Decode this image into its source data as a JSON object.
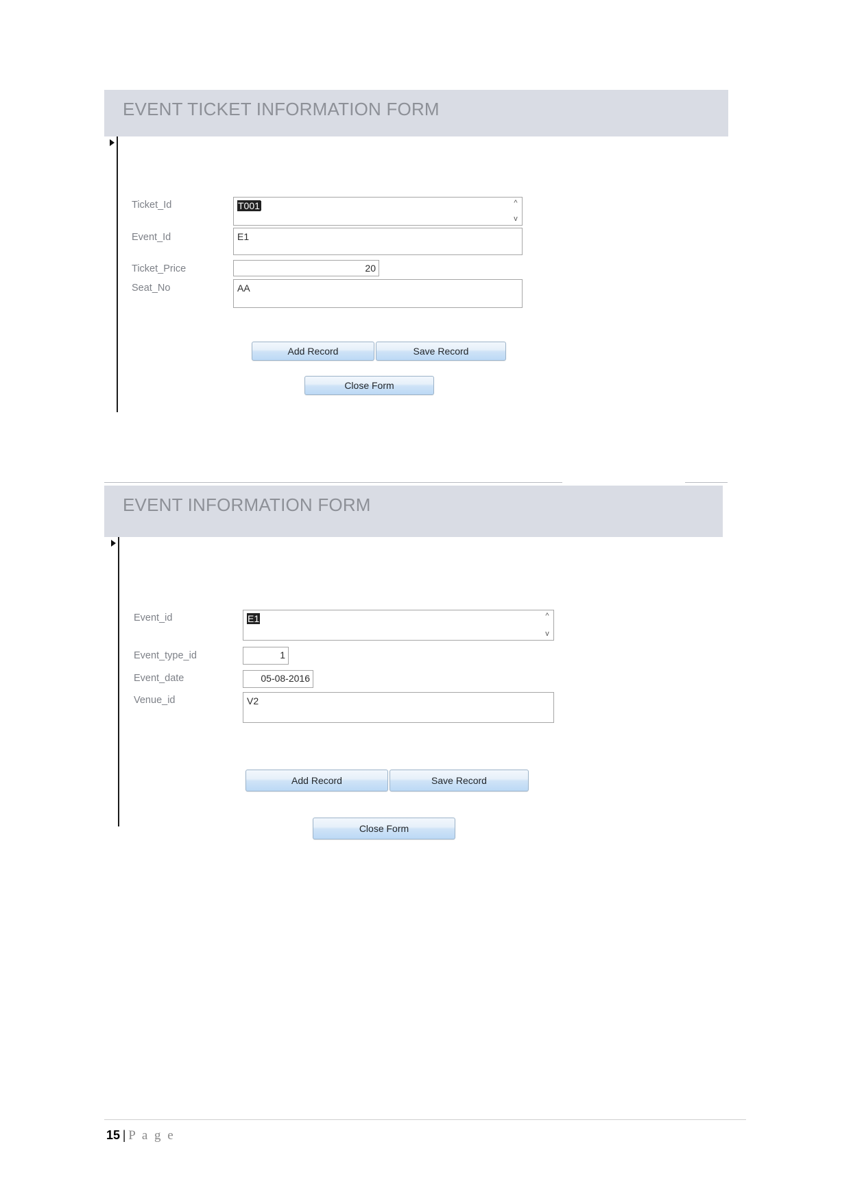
{
  "document": {
    "footer": {
      "page_number": "15",
      "separator": "|",
      "page_word": "P a g e"
    }
  },
  "forms": [
    {
      "id": "event-ticket-information-form",
      "title": "EVENT TICKET INFORMATION FORM",
      "fields": [
        {
          "label": "Ticket_Id",
          "value": "T001",
          "selected": true,
          "type": "text",
          "scroll_arrows": true
        },
        {
          "label": "Event_Id",
          "value": "E1",
          "selected": false,
          "type": "text",
          "scroll_arrows": false
        },
        {
          "label": "Ticket_Price",
          "value": "20",
          "selected": false,
          "type": "number",
          "scroll_arrows": false
        },
        {
          "label": "Seat_No",
          "value": "AA",
          "selected": false,
          "type": "text",
          "scroll_arrows": false
        }
      ],
      "buttons": {
        "add_record": "Add Record",
        "save_record": "Save Record",
        "close_form": "Close Form"
      }
    },
    {
      "id": "event-information-form",
      "title": "EVENT INFORMATION FORM",
      "fields": [
        {
          "label": "Event_id",
          "value": "E1",
          "selected": true,
          "type": "text",
          "scroll_arrows": true
        },
        {
          "label": "Event_type_id",
          "value": "1",
          "selected": false,
          "type": "number",
          "scroll_arrows": false
        },
        {
          "label": "Event_date",
          "value": "05-08-2016",
          "selected": false,
          "type": "number",
          "scroll_arrows": false
        },
        {
          "label": "Venue_id",
          "value": "V2",
          "selected": false,
          "type": "text",
          "scroll_arrows": false
        }
      ],
      "buttons": {
        "add_record": "Add Record",
        "save_record": "Save Record",
        "close_form": "Close Form"
      }
    }
  ],
  "icons": {
    "record_selector": "right-triangle-icon",
    "scroll_up": "chevron-up-icon",
    "scroll_down": "chevron-down-icon"
  },
  "colors": {
    "header_bg": "#d9dce4",
    "header_text": "#8d9097",
    "label_text": "#7d8087",
    "button_blue": "#bcd9f5",
    "selection_bg": "#222222"
  }
}
